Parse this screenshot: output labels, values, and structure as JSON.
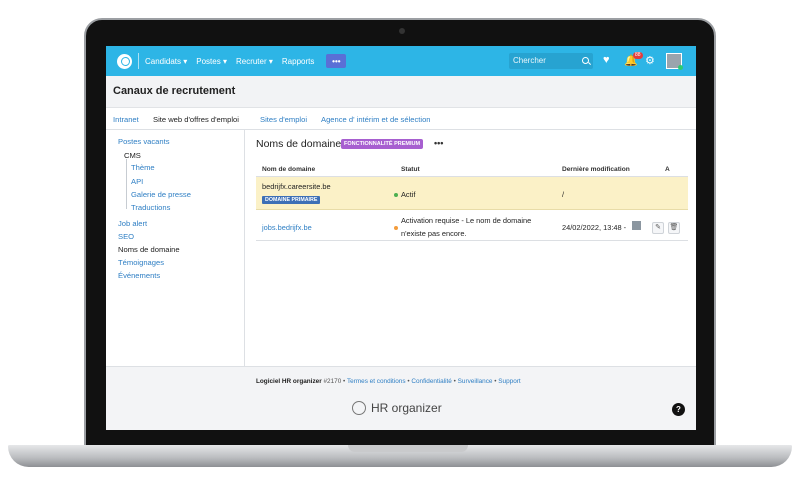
{
  "topnav": {
    "items": [
      "Candidats ▾",
      "Postes ▾",
      "Recruter ▾",
      "Rapports"
    ],
    "more": "•••",
    "search_placeholder": "Chercher",
    "notification_count": "88",
    "accent": "#2db5e6"
  },
  "header": {
    "title": "Canaux de recrutement"
  },
  "subtabs": [
    "Intranet",
    "Site web d'offres d'emploi",
    "Sites d'emploi",
    "Agence d' intérim et de sélection"
  ],
  "sidebar": {
    "items": [
      "Postes vacants",
      "CMS",
      "Thème",
      "API",
      "Galerie de presse",
      "Traductions",
      "Job alert",
      "SEO",
      "Noms de domaine",
      "Témoignages",
      "Événements"
    ]
  },
  "main": {
    "title": "Noms de domaine",
    "premium_badge": "FONCTIONNALITÉ PREMIUM",
    "more": "•••",
    "columns": [
      "Nom de domaine",
      "Statut",
      "Dernière modification",
      "A"
    ],
    "rows": [
      {
        "domain": "bedrijfx.careersite.be",
        "badge": "DOMAINE PRIMAIRE",
        "status": "Actif",
        "status_color": "#4caf50",
        "modified": "/"
      },
      {
        "domain": "jobs.bedrijfx.be",
        "status_line1": "Activation requise - Le nom de domaine",
        "status_line2": "n'existe pas encore.",
        "status_color": "#f39c3c",
        "modified": "24/02/2022, 13:48 -"
      }
    ]
  },
  "footer": {
    "product": "Logiciel HR organizer",
    "build": "#2170",
    "links": [
      "Termes et conditions",
      "Confidentialité",
      "Surveillance",
      "Support"
    ],
    "brand": "HR organizer",
    "help": "?"
  }
}
